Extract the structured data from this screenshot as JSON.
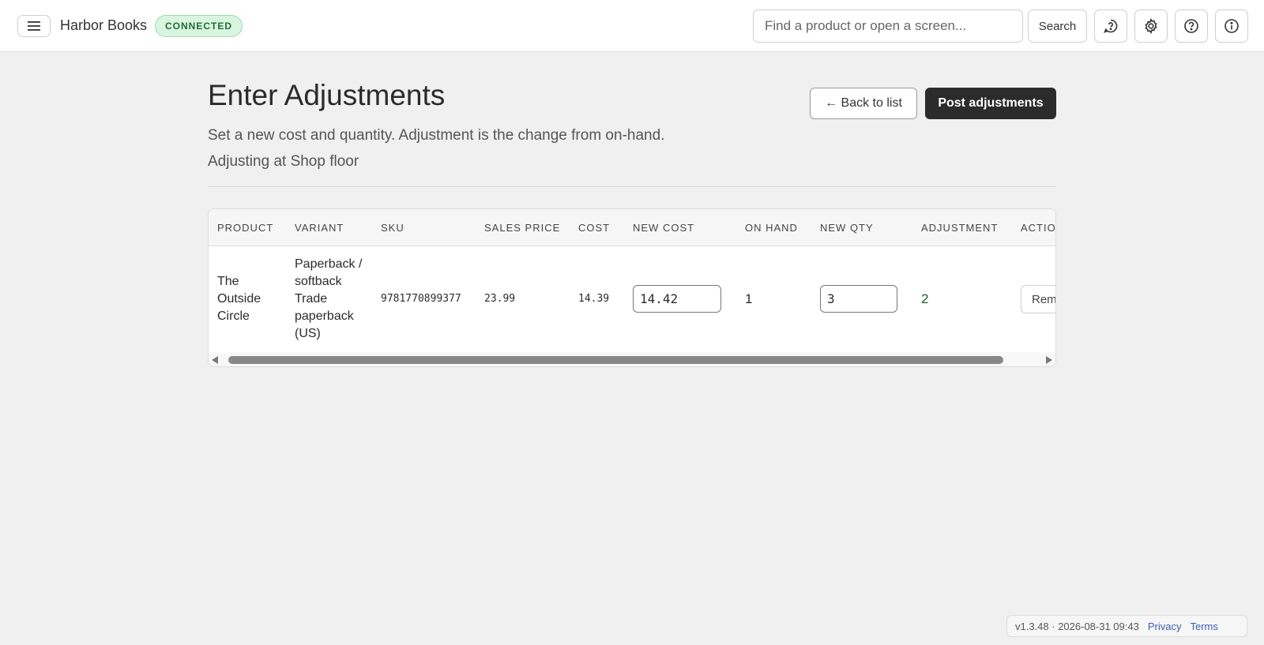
{
  "header": {
    "app_title": "Harbor Books",
    "status": "CONNECTED",
    "search_placeholder": "Find a product or open a screen...",
    "search_label": "Search",
    "icons": [
      "feedback-icon",
      "gear-icon",
      "help-icon",
      "info-icon"
    ]
  },
  "page": {
    "title": "Enter Adjustments",
    "subtitle": "Set a new cost and quantity. Adjustment is the change from on-hand.",
    "location": "Adjusting at Shop floor",
    "back_label": "← Back to list",
    "post_label": "Post adjustments"
  },
  "table": {
    "columns": [
      "PRODUCT",
      "VARIANT",
      "SKU",
      "SALES PRICE",
      "COST",
      "NEW COST",
      "ON HAND",
      "NEW QTY",
      "ADJUSTMENT",
      "ACTIONS"
    ],
    "rows": [
      {
        "product": "The Outside Circle",
        "variant": "Paperback / softback Trade paperback (US)",
        "sku": "9781770899377",
        "sales_price": "23.99",
        "cost": "14.39",
        "new_cost": "14.42",
        "on_hand": "1",
        "new_qty": "3",
        "adjustment": "2",
        "action_label": "Remove"
      }
    ],
    "horizontal_scroll_fraction": 0.0
  },
  "footer": {
    "version": "v1.3.48 · 2026-08-31 09:43",
    "privacy": "Privacy",
    "terms": "Terms"
  },
  "colors": {
    "primary_button": "#2b2b2b",
    "status_bg": "#d9f5df",
    "status_text": "#1f6b35",
    "link": "#3a5fb0"
  }
}
